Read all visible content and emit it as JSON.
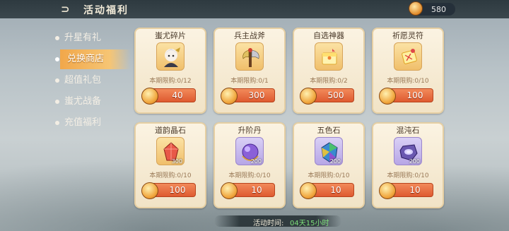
{
  "header": {
    "title": "活动福利",
    "currency_amount": "580"
  },
  "sidebar": {
    "items": [
      {
        "label": "升星有礼"
      },
      {
        "label": "兑换商店"
      },
      {
        "label": "超值礼包"
      },
      {
        "label": "蚩尤战备"
      },
      {
        "label": "充值福利"
      }
    ]
  },
  "shop": {
    "cards": [
      {
        "name": "蚩尤碎片",
        "limit": "本期限购:0/12",
        "price": "40",
        "icon": "character-portrait-icon"
      },
      {
        "name": "兵主战斧",
        "limit": "本期限购:0/1",
        "price": "300",
        "icon": "battle-axe-icon"
      },
      {
        "name": "自选神器",
        "limit": "本期限购:0/2",
        "price": "500",
        "icon": "artifact-chest-icon"
      },
      {
        "name": "祈愿灵符",
        "limit": "本期限购:0/10",
        "price": "100",
        "icon": "talisman-icon"
      },
      {
        "name": "道韵晶石",
        "limit": "本期限购:0/10",
        "price": "100",
        "icon": "red-crystal-icon",
        "qty": "300"
      },
      {
        "name": "升阶丹",
        "limit": "本期限购:0/10",
        "price": "10",
        "icon": "purple-pill-icon",
        "qty": "200"
      },
      {
        "name": "五色石",
        "limit": "本期限购:0/10",
        "price": "10",
        "icon": "rainbow-stone-icon",
        "qty": "200"
      },
      {
        "name": "混沌石",
        "limit": "本期限购:0/10",
        "price": "10",
        "icon": "chaos-stone-icon",
        "qty": "200"
      }
    ]
  },
  "footer": {
    "label": "活动时间:",
    "value": "04天15小时"
  }
}
